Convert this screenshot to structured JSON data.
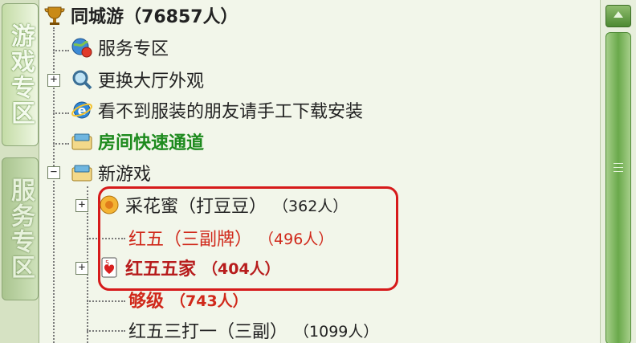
{
  "side_tabs": [
    {
      "label": "游戏专区",
      "active": true
    },
    {
      "label": "服务专区",
      "active": false
    }
  ],
  "tree": {
    "root": {
      "label": "同城游",
      "count": "（76857人）"
    },
    "items": [
      {
        "label": "服务专区"
      },
      {
        "label": "更换大厅外观"
      },
      {
        "label": "看不到服装的朋友请手工下载安装"
      },
      {
        "label": "房间快速通道"
      },
      {
        "label": "新游戏"
      }
    ],
    "games": [
      {
        "label": "采花蜜（打豆豆）",
        "count": "（362人）"
      },
      {
        "label": "红五（三副牌）",
        "count": "（496人）"
      },
      {
        "label": "红五五家",
        "count": "（404人）"
      },
      {
        "label": "够级",
        "count": "（743人）"
      },
      {
        "label": "红五三打一（三副）",
        "count": "（1099人）"
      }
    ]
  },
  "colors": {
    "highlight_border": "#d61a1a",
    "fast_channel": "#1d8a1d",
    "red_game": "#d0281a"
  }
}
